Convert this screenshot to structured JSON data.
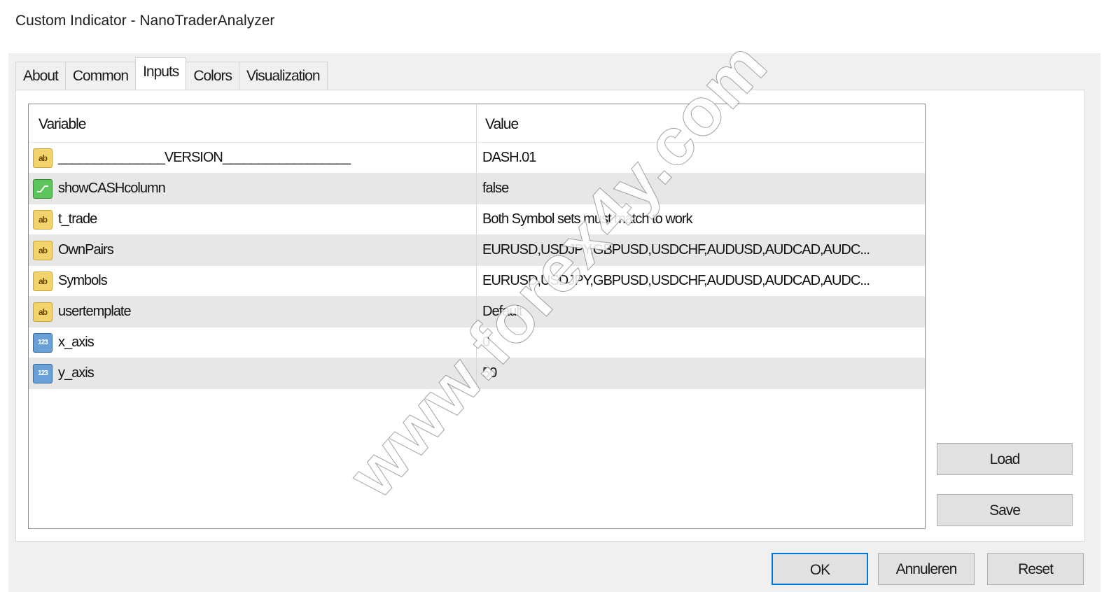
{
  "window": {
    "title": "Custom Indicator - NanoTraderAnalyzer"
  },
  "tabs": [
    {
      "label": "About",
      "active": false
    },
    {
      "label": "Common",
      "active": false
    },
    {
      "label": "Inputs",
      "active": true
    },
    {
      "label": "Colors",
      "active": false
    },
    {
      "label": "Visualization",
      "active": false
    }
  ],
  "grid": {
    "columns": {
      "variable": "Variable",
      "value": "Value"
    },
    "rows": [
      {
        "icon": "string-type-icon",
        "variable": "_______________VERSION__________________",
        "value": "DASH.01"
      },
      {
        "icon": "bool-type-icon",
        "variable": "showCASHcolumn",
        "value": "false"
      },
      {
        "icon": "string-type-icon",
        "variable": "t_trade",
        "value": "Both Symbol sets must match to work"
      },
      {
        "icon": "string-type-icon",
        "variable": "OwnPairs",
        "value": "EURUSD,USDJPY,GBPUSD,USDCHF,AUDUSD,AUDCAD,AUDC..."
      },
      {
        "icon": "string-type-icon",
        "variable": "Symbols",
        "value": "EURUSD,USDJPY,GBPUSD,USDCHF,AUDUSD,AUDCAD,AUDC..."
      },
      {
        "icon": "string-type-icon",
        "variable": "usertemplate",
        "value": "Default"
      },
      {
        "icon": "number-type-icon",
        "variable": "x_axis",
        "value": "0"
      },
      {
        "icon": "number-type-icon",
        "variable": "y_axis",
        "value": "50"
      }
    ]
  },
  "icons": {
    "string_glyph": "ab",
    "number_glyph": "123"
  },
  "buttons": {
    "load": "Load",
    "save": "Save",
    "ok": "OK",
    "cancel": "Annuleren",
    "reset": "Reset"
  },
  "watermark": "www.forex4y.com"
}
